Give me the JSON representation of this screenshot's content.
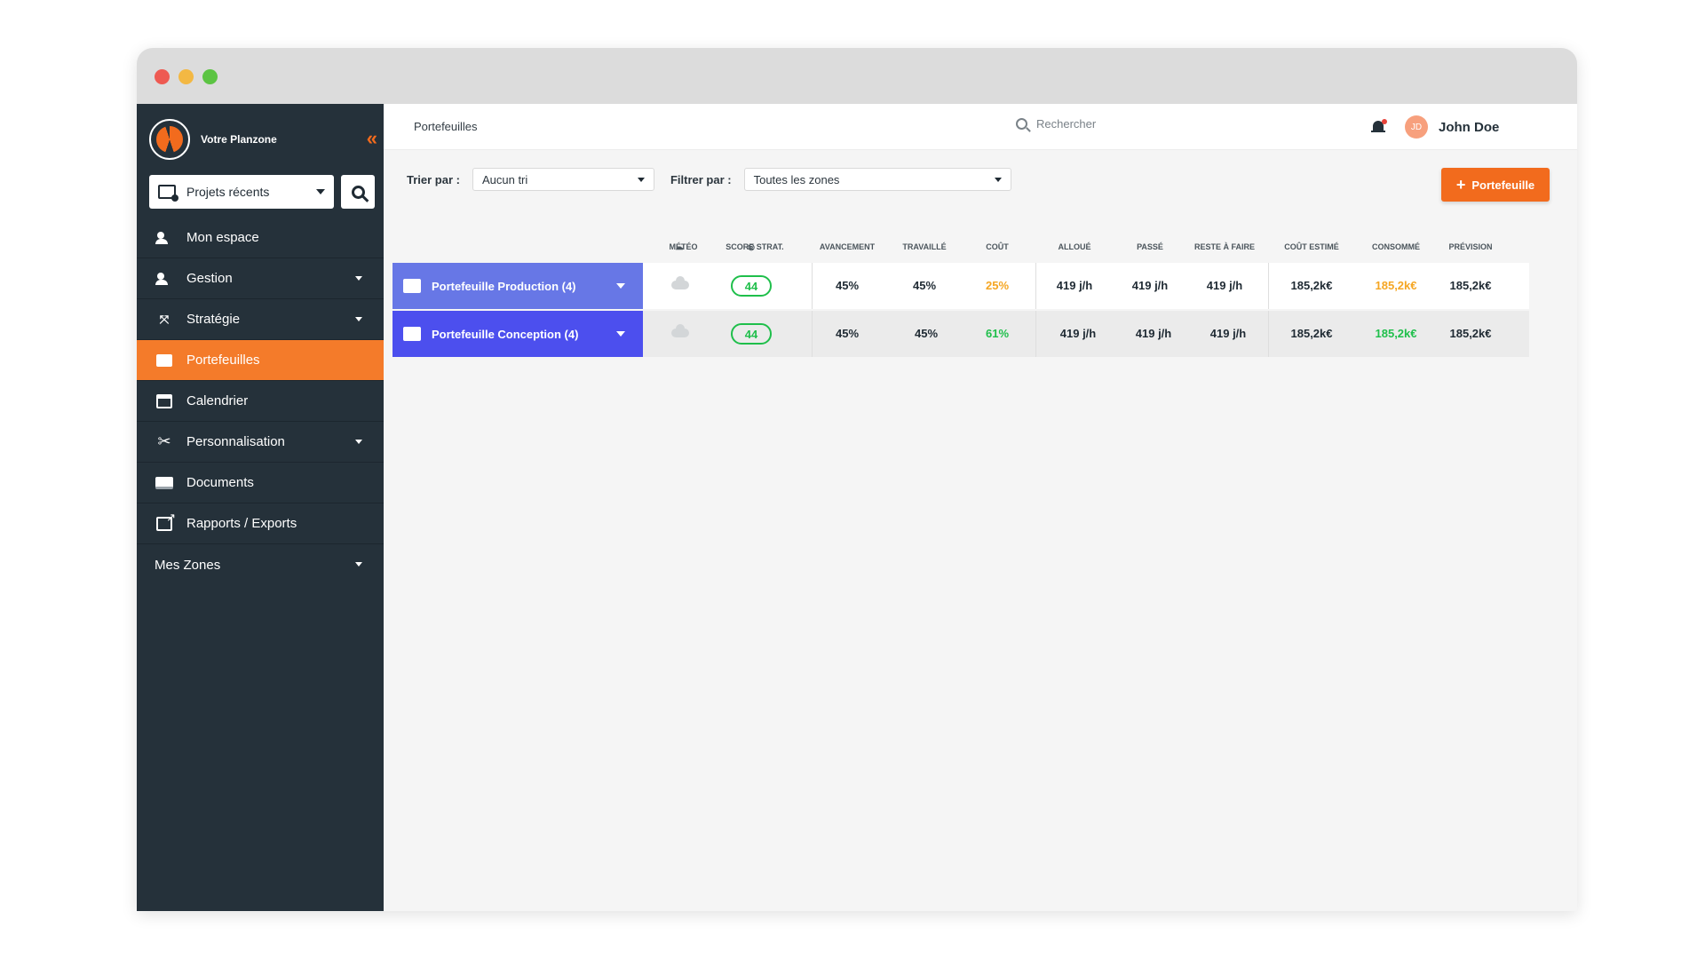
{
  "brand": {
    "name": "Votre Planzone"
  },
  "recent": {
    "label": "Projets récents"
  },
  "nav": [
    {
      "label": "Mon espace",
      "icon": "user-space-icon"
    },
    {
      "label": "Gestion",
      "icon": "people-icon"
    },
    {
      "label": "Stratégie",
      "icon": "strategy-icon"
    },
    {
      "label": "Portefeuilles",
      "icon": "portfolio-icon"
    },
    {
      "label": "Calendrier",
      "icon": "calendar-icon"
    },
    {
      "label": "Personnalisation",
      "icon": "tools-icon"
    },
    {
      "label": "Documents",
      "icon": "documents-icon"
    },
    {
      "label": "Rapports / Exports",
      "icon": "export-icon"
    }
  ],
  "zones": {
    "label": "Mes Zones"
  },
  "header": {
    "title": "Portefeuilles",
    "search_placeholder": "Rechercher",
    "user_initials": "JD",
    "user_name": "John Doe"
  },
  "filters": {
    "sort_label": "Trier par :",
    "sort_value": "Aucun tri",
    "filter_label": "Filtrer par :",
    "filter_value": "Toutes les zones",
    "add_label": "Portefeuille"
  },
  "columns": {
    "meteo": "MÉTÉO",
    "score": "SCORE STRAT.",
    "avancement": "AVANCEMENT",
    "travaille": "TRAVAILLÉ",
    "cout": "COÛT",
    "alloue": "ALLOUÉ",
    "passe": "PASSÉ",
    "reste": "RESTE À FAIRE",
    "cout_estime": "COÛT ESTIMÉ",
    "consomme": "CONSOMMÉ",
    "prevision": "PRÉVISION"
  },
  "rows": [
    {
      "name": "Portefeuille Production (4)",
      "score": "44",
      "avancement": "45%",
      "travaille": "45%",
      "cout": "25%",
      "alloue": "419 j/h",
      "passe": "419 j/h",
      "reste": "419 j/h",
      "cout_estime": "185,2k€",
      "consomme": "185,2k€",
      "prevision": "185,2k€"
    },
    {
      "name": "Portefeuille Conception (4)",
      "score": "44",
      "avancement": "45%",
      "travaille": "45%",
      "cout": "61%",
      "alloue": "419 j/h",
      "passe": "419 j/h",
      "reste": "419 j/h",
      "cout_estime": "185,2k€",
      "consomme": "185,2k€",
      "prevision": "185,2k€"
    }
  ],
  "colors": {
    "accent": "#f26b1d",
    "warning": "#f5a623",
    "success": "#1fbf4b",
    "production": "#6777e6",
    "conception": "#4c4fee"
  }
}
